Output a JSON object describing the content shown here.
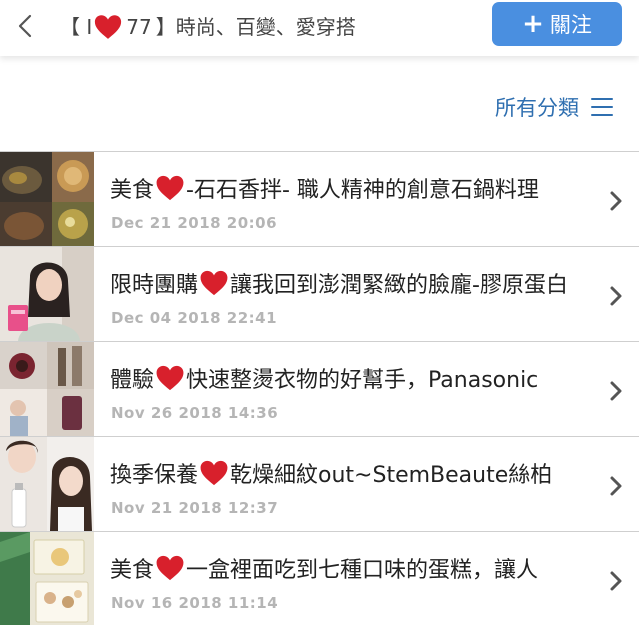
{
  "header": {
    "back_icon": "chevron-left-icon",
    "title_prefix": "【 I",
    "title_count": "77",
    "title_suffix": "】時尚、百變、愛穿搭",
    "follow_label": "關注",
    "follow_icon": "plus-icon"
  },
  "categories": {
    "label": "所有分類",
    "icon": "menu-icon"
  },
  "posts": [
    {
      "title_before": "美食",
      "title_after": "-石石香拌- 職人精神的創意石鍋料理",
      "date": "Dec 21 2018 20:06"
    },
    {
      "title_before": "限時團購",
      "title_after": "讓我回到澎潤緊緻的臉龐-膠原蛋白",
      "date": "Dec 04 2018 22:41"
    },
    {
      "title_before": "體驗",
      "title_after": "快速整燙衣物的好幫手，Panasonic",
      "date": "Nov 26 2018 14:36"
    },
    {
      "title_before": "換季保養",
      "title_after": "乾燥細紋out~StemBeaute絲柏",
      "date": "Nov 21 2018 12:37"
    },
    {
      "title_before": "美食",
      "title_after": "一盒裡面吃到七種口味的蛋糕，讓人",
      "date": "Nov 16 2018 11:14"
    }
  ],
  "colors": {
    "accent": "#4a8fe0",
    "category_text": "#2f6fb0",
    "heart": "#d8202c",
    "date_text": "#b5b5b5"
  }
}
